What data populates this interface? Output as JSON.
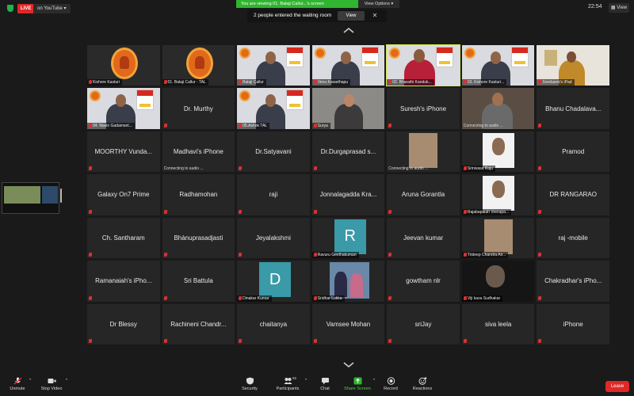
{
  "top": {
    "live_label": "LIVE",
    "stream_label": "on YouTube",
    "share_banner": "You are viewing 01. Balaji Callur...'s screen",
    "view_options": "View Options",
    "waiting_text": "2 people entered the waiting room",
    "view_button": "View",
    "clock": "22:54",
    "view_top": "View"
  },
  "tiles": [
    {
      "name": "Kishore Kasturi",
      "kind": "emblem"
    },
    {
      "name": "01. Balaji Callur - TAL",
      "kind": "emblem"
    },
    {
      "name": "Balaji Callur",
      "kind": "person-tal"
    },
    {
      "name": "Venu Kavarthapu",
      "kind": "person-tal"
    },
    {
      "name": "02. Bharathi Kanduk...",
      "kind": "person-tal-f"
    },
    {
      "name": "03. Kishore Kasturi...",
      "kind": "person-tal"
    },
    {
      "name": "Sreelaxmi's iPad",
      "kind": "person-wall"
    },
    {
      "name": "04. Navin Gadamset...",
      "kind": "person-tal"
    },
    {
      "name": "Dr. Murthy",
      "kind": "text"
    },
    {
      "name": "05.Ashok TAL",
      "kind": "person-tal"
    },
    {
      "name": "Surya",
      "kind": "person-room"
    },
    {
      "name": "Suresh's iPhone",
      "kind": "text"
    },
    {
      "name": "",
      "kind": "person-dark",
      "audio": "Connecting to audio ..."
    },
    {
      "name": "Bhanu Chadalava...",
      "kind": "text"
    },
    {
      "name": "MOORTHY Vunda...",
      "kind": "text"
    },
    {
      "name": "Madhavi's iPhone",
      "kind": "text",
      "audio": "Connecting to audio ..."
    },
    {
      "name": "Dr.Satyavani",
      "kind": "text"
    },
    {
      "name": "Dr.Durgaprasad s...",
      "kind": "text"
    },
    {
      "name": "",
      "kind": "photo",
      "audio": "Connecting to audio ..."
    },
    {
      "name": "Srinivasa Raju",
      "kind": "photo-white"
    },
    {
      "name": "Pramod",
      "kind": "text"
    },
    {
      "name": "Galaxy On7 Prime",
      "kind": "text"
    },
    {
      "name": "Radhamohan",
      "kind": "text"
    },
    {
      "name": "raji",
      "kind": "text"
    },
    {
      "name": "Jonnalagadda Kra...",
      "kind": "text"
    },
    {
      "name": "Aruna Gorantla",
      "kind": "text"
    },
    {
      "name": "Rajabapaiah Veerapa...",
      "kind": "photo-white"
    },
    {
      "name": "DR RANGARAO",
      "kind": "text"
    },
    {
      "name": "Ch. Santharam",
      "kind": "text"
    },
    {
      "name": "Bhànuprasadjasti",
      "kind": "text"
    },
    {
      "name": "Jeyalakshmi",
      "kind": "text"
    },
    {
      "name": "Ravuru Geethakumari",
      "kind": "letter",
      "letter": "R"
    },
    {
      "name": "Jeevan kumar",
      "kind": "text"
    },
    {
      "name": "Trideep Chandra Air...",
      "kind": "photo"
    },
    {
      "name": "raj -mobile",
      "kind": "text"
    },
    {
      "name": "Ramanaiah's iPho...",
      "kind": "text"
    },
    {
      "name": "Sri Battula",
      "kind": "text"
    },
    {
      "name": "Dinakar Kumar",
      "kind": "letter",
      "letter": "D"
    },
    {
      "name": "Sridhar Lukka",
      "kind": "photo-couple"
    },
    {
      "name": "gowtham nlr",
      "kind": "text"
    },
    {
      "name": "Viji kaza Sudhakar",
      "kind": "photo-dark"
    },
    {
      "name": "Chakradhar's iPho...",
      "kind": "text"
    },
    {
      "name": "Dr Blessy",
      "kind": "text"
    },
    {
      "name": "Rachineni Chandr...",
      "kind": "text"
    },
    {
      "name": "chaitanya",
      "kind": "text"
    },
    {
      "name": "Vamsee Mohan",
      "kind": "text"
    },
    {
      "name": "sriJay",
      "kind": "text"
    },
    {
      "name": "siva leela",
      "kind": "text"
    },
    {
      "name": "iPhone",
      "kind": "text"
    }
  ],
  "toolbar": {
    "unmute": "Unmute",
    "stop_video": "Stop Video",
    "security": "Security",
    "participants": "Participants",
    "participants_count": "55",
    "chat": "Chat",
    "share_screen": "Share Screen",
    "record": "Record",
    "reactions": "Reactions",
    "leave": "Leave"
  },
  "colors": {
    "accent_green": "#2fb52f",
    "leave_red": "#e02828",
    "speaker_outline": "#d6e84a"
  }
}
